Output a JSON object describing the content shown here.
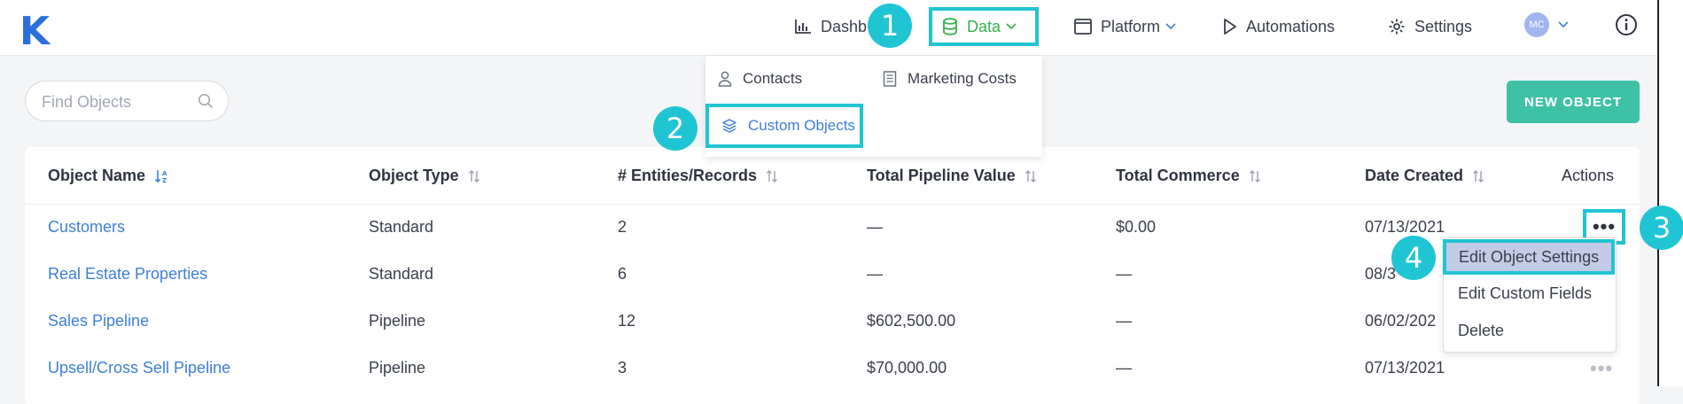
{
  "app": {
    "logo": "K"
  },
  "nav": {
    "dashboard": "Dashb",
    "data": "Data",
    "platform": "Platform",
    "automations": "Automations",
    "settings": "Settings",
    "avatar_initials": "MC"
  },
  "data_menu": {
    "contacts": "Contacts",
    "marketing_costs": "Marketing Costs",
    "custom_objects": "Custom Objects"
  },
  "search": {
    "placeholder": "Find Objects",
    "value": ""
  },
  "new_object_button": "NEW OBJECT",
  "table": {
    "headers": {
      "name": "Object Name",
      "type": "Object Type",
      "records": "# Entities/Records",
      "pipeline": "Total Pipeline Value",
      "commerce": "Total Commerce",
      "date": "Date Created",
      "actions": "Actions"
    },
    "rows": [
      {
        "name": "Customers",
        "type": "Standard",
        "records": "2",
        "pipeline": "—",
        "commerce": "$0.00",
        "date": "07/13/2021"
      },
      {
        "name": "Real Estate Properties",
        "type": "Standard",
        "records": "6",
        "pipeline": "—",
        "commerce": "—",
        "date": "08/3"
      },
      {
        "name": "Sales Pipeline",
        "type": "Pipeline",
        "records": "12",
        "pipeline": "$602,500.00",
        "commerce": "—",
        "date": "06/02/202"
      },
      {
        "name": "Upsell/Cross Sell Pipeline",
        "type": "Pipeline",
        "records": "3",
        "pipeline": "$70,000.00",
        "commerce": "—",
        "date": "07/13/2021"
      }
    ],
    "more_glyph": "•••"
  },
  "actions_menu": {
    "edit_settings": "Edit Object Settings",
    "edit_fields": "Edit Custom Fields",
    "delete": "Delete"
  },
  "steps": [
    "1",
    "2",
    "3",
    "4"
  ],
  "colors": {
    "accent": "#20c5d4",
    "link": "#3e7fd8",
    "data_green": "#37b24d",
    "button": "#3fc1a5",
    "logo": "#2c6fdb"
  }
}
